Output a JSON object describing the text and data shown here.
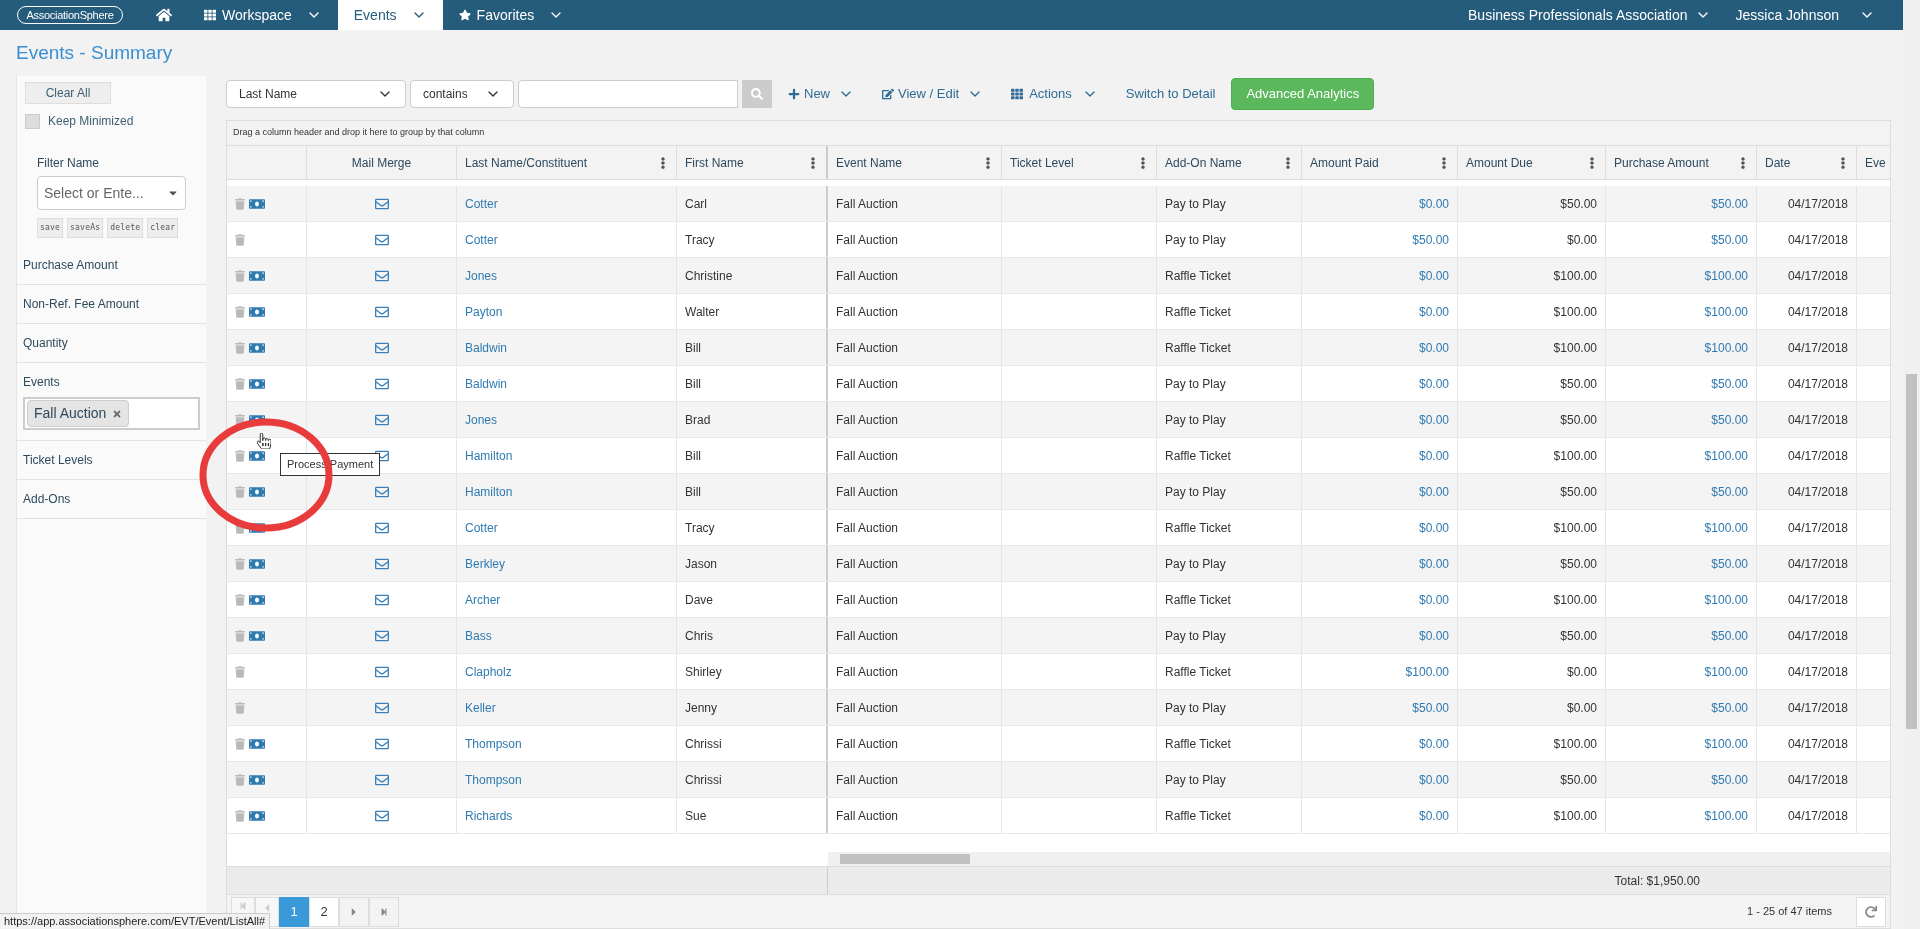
{
  "nav": {
    "logo": "AssociationSphere",
    "items": [
      {
        "label": "Workspace",
        "selected": false
      },
      {
        "label": "Events",
        "selected": true
      },
      {
        "label": "Favorites",
        "selected": false
      }
    ],
    "org": "Business Professionals Association",
    "user": "Jessica Johnson"
  },
  "page_title": "Events - Summary",
  "sidebar": {
    "clear_all": "Clear All",
    "keep_minimized": {
      "label": "Keep Minimized",
      "checked": false
    },
    "filter_name": {
      "label": "Filter Name",
      "placeholder": "Select or Ente..."
    },
    "filter_buttons": [
      "save",
      "saveAs",
      "delete",
      "clear"
    ],
    "filters": [
      {
        "label": "Purchase Amount"
      },
      {
        "label": "Non-Ref. Fee Amount"
      },
      {
        "label": "Quantity"
      },
      {
        "label": "Events",
        "chips": [
          "Fall Auction"
        ]
      },
      {
        "label": "Ticket Levels"
      },
      {
        "label": "Add-Ons"
      }
    ]
  },
  "toolbar": {
    "field": "Last Name",
    "operator": "contains",
    "new": "New",
    "view_edit": "View / Edit",
    "actions": "Actions",
    "switch": "Switch to Detail",
    "analytics": "Advanced Analytics"
  },
  "grid": {
    "group_hint": "Drag a column header and drop it here to group by that column",
    "columns": [
      {
        "label": "Mail Merge",
        "menu": false
      },
      {
        "label": "Last Name/Constituent",
        "menu": true
      },
      {
        "label": "First Name",
        "menu": true
      },
      {
        "label": "Event Name",
        "menu": true
      },
      {
        "label": "Ticket Level",
        "menu": true
      },
      {
        "label": "Add-On Name",
        "menu": true
      },
      {
        "label": "Amount Paid",
        "menu": true
      },
      {
        "label": "Amount Due",
        "menu": true
      },
      {
        "label": "Purchase Amount",
        "menu": true
      },
      {
        "label": "Date",
        "menu": true
      },
      {
        "label": "Eve",
        "menu": false
      }
    ],
    "rows": [
      {
        "payment": true,
        "last": "Cotter",
        "first": "Carl",
        "event": "Fall Auction",
        "addon": "Pay to Play",
        "paid": "$0.00",
        "due": "$50.00",
        "purchase": "$50.00",
        "date": "04/17/2018"
      },
      {
        "payment": false,
        "last": "Cotter",
        "first": "Tracy",
        "event": "Fall Auction",
        "addon": "Pay to Play",
        "paid": "$50.00",
        "due": "$0.00",
        "purchase": "$50.00",
        "date": "04/17/2018"
      },
      {
        "payment": true,
        "last": "Jones",
        "first": "Christine",
        "event": "Fall Auction",
        "addon": "Raffle Ticket",
        "paid": "$0.00",
        "due": "$100.00",
        "purchase": "$100.00",
        "date": "04/17/2018"
      },
      {
        "payment": true,
        "last": "Payton",
        "first": "Walter",
        "event": "Fall Auction",
        "addon": "Raffle Ticket",
        "paid": "$0.00",
        "due": "$100.00",
        "purchase": "$100.00",
        "date": "04/17/2018"
      },
      {
        "payment": true,
        "last": "Baldwin",
        "first": "Bill",
        "event": "Fall Auction",
        "addon": "Raffle Ticket",
        "paid": "$0.00",
        "due": "$100.00",
        "purchase": "$100.00",
        "date": "04/17/2018"
      },
      {
        "payment": true,
        "last": "Baldwin",
        "first": "Bill",
        "event": "Fall Auction",
        "addon": "Pay to Play",
        "paid": "$0.00",
        "due": "$50.00",
        "purchase": "$50.00",
        "date": "04/17/2018"
      },
      {
        "payment": true,
        "last": "Jones",
        "first": "Brad",
        "event": "Fall Auction",
        "addon": "Pay to Play",
        "paid": "$0.00",
        "due": "$50.00",
        "purchase": "$50.00",
        "date": "04/17/2018"
      },
      {
        "payment": true,
        "last": "Hamilton",
        "first": "Bill",
        "event": "Fall Auction",
        "addon": "Raffle Ticket",
        "paid": "$0.00",
        "due": "$100.00",
        "purchase": "$100.00",
        "date": "04/17/2018"
      },
      {
        "payment": true,
        "last": "Hamilton",
        "first": "Bill",
        "event": "Fall Auction",
        "addon": "Pay to Play",
        "paid": "$0.00",
        "due": "$50.00",
        "purchase": "$50.00",
        "date": "04/17/2018"
      },
      {
        "payment": true,
        "last": "Cotter",
        "first": "Tracy",
        "event": "Fall Auction",
        "addon": "Raffle Ticket",
        "paid": "$0.00",
        "due": "$100.00",
        "purchase": "$100.00",
        "date": "04/17/2018"
      },
      {
        "payment": true,
        "last": "Berkley",
        "first": "Jason",
        "event": "Fall Auction",
        "addon": "Pay to Play",
        "paid": "$0.00",
        "due": "$50.00",
        "purchase": "$50.00",
        "date": "04/17/2018"
      },
      {
        "payment": true,
        "last": "Archer",
        "first": "Dave",
        "event": "Fall Auction",
        "addon": "Raffle Ticket",
        "paid": "$0.00",
        "due": "$100.00",
        "purchase": "$100.00",
        "date": "04/17/2018"
      },
      {
        "payment": true,
        "last": "Bass",
        "first": "Chris",
        "event": "Fall Auction",
        "addon": "Pay to Play",
        "paid": "$0.00",
        "due": "$50.00",
        "purchase": "$50.00",
        "date": "04/17/2018"
      },
      {
        "payment": false,
        "last": "Clapholz",
        "first": "Shirley",
        "event": "Fall Auction",
        "addon": "Raffle Ticket",
        "paid": "$100.00",
        "due": "$0.00",
        "purchase": "$100.00",
        "date": "04/17/2018"
      },
      {
        "payment": false,
        "last": "Keller",
        "first": "Jenny",
        "event": "Fall Auction",
        "addon": "Pay to Play",
        "paid": "$50.00",
        "due": "$0.00",
        "purchase": "$50.00",
        "date": "04/17/2018"
      },
      {
        "payment": true,
        "last": "Thompson",
        "first": "Chrissi",
        "event": "Fall Auction",
        "addon": "Raffle Ticket",
        "paid": "$0.00",
        "due": "$100.00",
        "purchase": "$100.00",
        "date": "04/17/2018"
      },
      {
        "payment": true,
        "last": "Thompson",
        "first": "Chrissi",
        "event": "Fall Auction",
        "addon": "Pay to Play",
        "paid": "$0.00",
        "due": "$50.00",
        "purchase": "$50.00",
        "date": "04/17/2018"
      },
      {
        "payment": true,
        "last": "Richards",
        "first": "Sue",
        "event": "Fall Auction",
        "addon": "Raffle Ticket",
        "paid": "$0.00",
        "due": "$100.00",
        "purchase": "$100.00",
        "date": "04/17/2018"
      }
    ],
    "total": "Total: $1,950.00",
    "tooltip": "Process Payment",
    "pages": [
      {
        "label": "1",
        "selected": true
      },
      {
        "label": "2",
        "selected": false
      }
    ],
    "range": "1 - 25 of 47 items"
  },
  "status_url": "https://app.associationsphere.com/EVT/Event/ListAll#"
}
